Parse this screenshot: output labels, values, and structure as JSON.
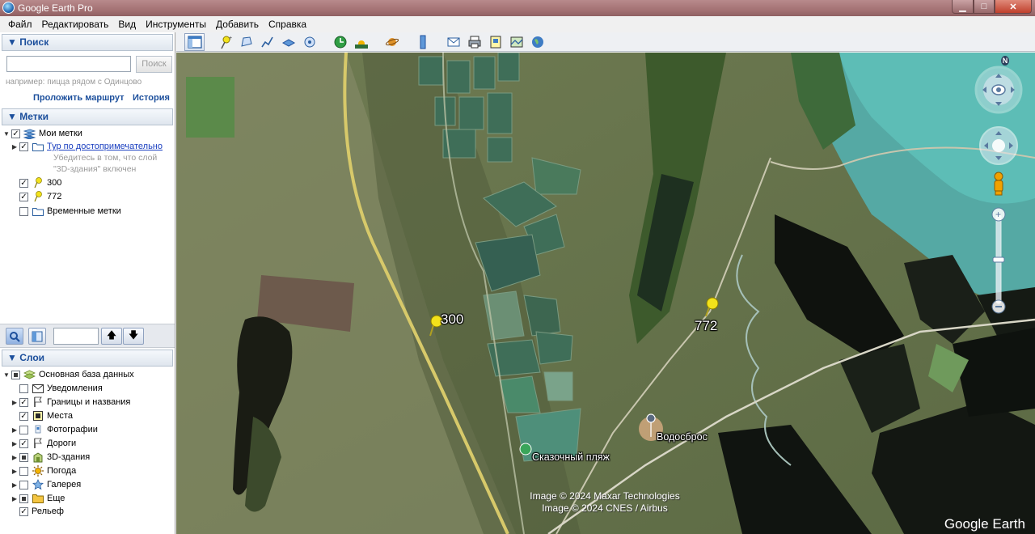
{
  "window": {
    "title": "Google Earth Pro",
    "minimize": "▁",
    "maximize": "□",
    "close": "✕"
  },
  "menu": [
    "Файл",
    "Редактировать",
    "Вид",
    "Инструменты",
    "Добавить",
    "Справка"
  ],
  "search": {
    "header": "▼ Поиск",
    "placeholder": "",
    "button": "Поиск",
    "hint": "например: пицца рядом с Одинцово",
    "route_link": "Проложить маршрут",
    "history_link": "История"
  },
  "places": {
    "header": "▼ Метки",
    "my_places": "Мои метки",
    "tour": "Тур по достопримечательно",
    "tour_note_1": "Убедитесь в том, что слой",
    "tour_note_2": "\"3D-здания\" включен",
    "mark_300": "300",
    "mark_772": "772",
    "temp_places": "Временные метки"
  },
  "layers": {
    "header": "▼ Слои",
    "items": [
      "Основная база данных",
      "Уведомления",
      "Границы и названия",
      "Места",
      "Фотографии",
      "Дороги",
      "3D-здания",
      "Погода",
      "Галерея",
      "Еще",
      "Рельеф"
    ]
  },
  "map": {
    "pin1_label": "300",
    "pin2_label": "772",
    "place1": "Водосброс",
    "place2": "Сказочный пляж",
    "credit1": "Image © 2024 Maxar Technologies",
    "credit2": "Image © 2024 CNES / Airbus",
    "brand": "Google Earth",
    "compass_north": "N"
  },
  "colors": {
    "accent": "#1c4f9c",
    "pin": "#f2e21b",
    "title_bar": "#a47274"
  }
}
